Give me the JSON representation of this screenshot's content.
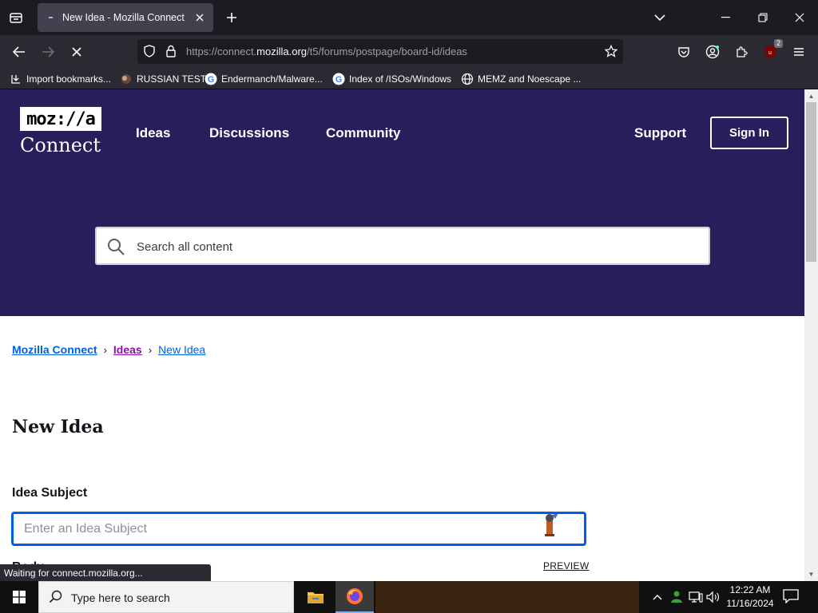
{
  "browser": {
    "tab_title": "New Idea - Mozilla Connect",
    "url_prefix": "https://connect.",
    "url_host": "mozilla.org",
    "url_path": "/t5/forums/postpage/board-id/ideas",
    "extension_badge": "2",
    "bookmarks": [
      {
        "label": "Import bookmarks...",
        "icon": "import-icon"
      },
      {
        "label": "RUSSIAN TEST",
        "icon": "site-favicon"
      },
      {
        "label": "Endermanch/Malware...",
        "icon": "google-icon"
      },
      {
        "label": "Index of /ISOs/Windows",
        "icon": "google-icon"
      },
      {
        "label": "MEMZ and Noescape ...",
        "icon": "globe-icon"
      }
    ],
    "status_text": "Waiting for connect.mozilla.org..."
  },
  "site": {
    "logo_top": "moz://a",
    "logo_bottom": "Connect",
    "nav": [
      "Ideas",
      "Discussions",
      "Community"
    ],
    "support": "Support",
    "sign_in": "Sign In",
    "search_placeholder": "Search all content"
  },
  "breadcrumb": [
    "Mozilla Connect",
    "Ideas",
    "New Idea"
  ],
  "form": {
    "heading": "New Idea",
    "subject_label": "Idea Subject",
    "subject_placeholder": "Enter an Idea Subject",
    "body_label": "Body",
    "preview_label": "PREVIEW"
  },
  "taskbar": {
    "search_placeholder": "Type here to search",
    "time": "12:22 AM",
    "date": "11/16/2024"
  },
  "colors": {
    "hero_bg": "#291d5c",
    "link_blue": "#0060df",
    "visited_purple": "#8a13a8"
  }
}
